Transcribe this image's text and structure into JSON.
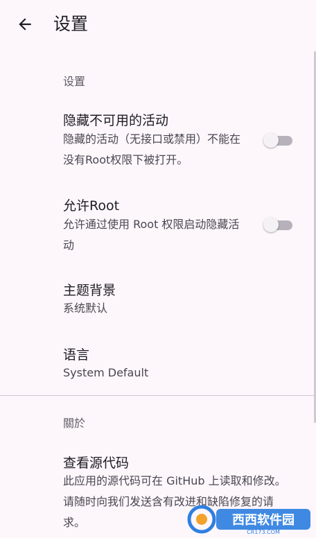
{
  "app_bar": {
    "title": "设置",
    "back_icon": "arrow-back-icon"
  },
  "section_settings": {
    "header": "设置",
    "items": [
      {
        "title": "隐藏不可用的活动",
        "summary": "隐藏的活动（无接口或禁用）不能在没有Root权限下被打开。",
        "switch_on": false
      },
      {
        "title": "允许Root",
        "summary": "允许通过使用 Root 权限启动隐藏活动",
        "switch_on": false
      },
      {
        "title": "主题背景",
        "summary": "系统默认"
      },
      {
        "title": "语言",
        "summary": "System Default"
      }
    ]
  },
  "section_about": {
    "header": "關於",
    "items": [
      {
        "title": "查看源代码",
        "summary": "此应用的源代码可在 GitHub 上读取和修改。请随时向我们发送含有改进和缺陷修复的请求。"
      }
    ]
  },
  "watermark": {
    "text": "西西软件园",
    "subtext": "CR173.COM",
    "colors": {
      "primary": "#2f7fe0",
      "accent": "#f2a12a"
    }
  },
  "colors": {
    "background": "#fdf7fc",
    "switch_track_off": "#b7b1bb",
    "switch_thumb_off": "#f5f2f6"
  }
}
